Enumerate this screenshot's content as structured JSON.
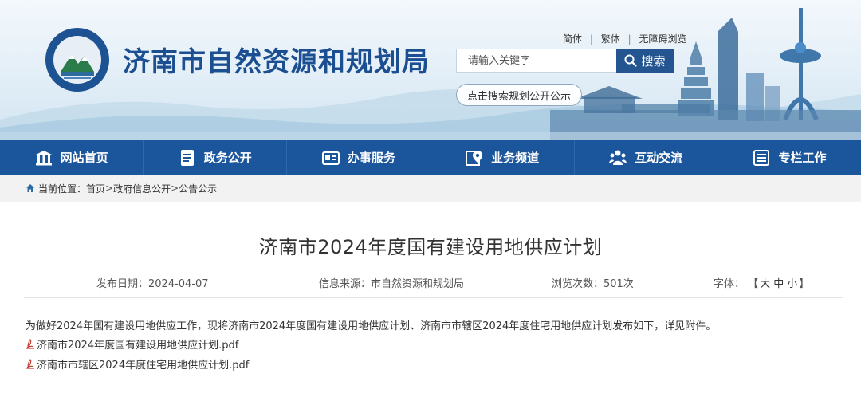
{
  "header": {
    "site_title": "济南市自然资源和规划局",
    "logo_text": "济南市自然资源和规划局",
    "lang_links": [
      "简体",
      "繁体",
      "无障碍浏览"
    ],
    "search_placeholder": "请输入关键字",
    "search_button": "搜索",
    "search_plan_link": "点击搜索规划公开公示"
  },
  "nav": {
    "items": [
      {
        "label": "网站首页",
        "icon": "building-icon"
      },
      {
        "label": "政务公开",
        "icon": "document-icon"
      },
      {
        "label": "办事服务",
        "icon": "id-card-icon"
      },
      {
        "label": "业务频道",
        "icon": "map-pin-icon"
      },
      {
        "label": "互动交流",
        "icon": "people-icon"
      },
      {
        "label": "专栏工作",
        "icon": "panel-icon"
      }
    ]
  },
  "breadcrumb": {
    "prefix": "当前位置：",
    "items": [
      "首页",
      "政府信息公开",
      "公告公示"
    ],
    "separator": ">"
  },
  "article": {
    "title": "济南市2024年度国有建设用地供应计划",
    "meta": {
      "date_label": "发布日期：",
      "date": "2024-04-07",
      "source_label": "信息来源：",
      "source": "市自然资源和规划局",
      "views_label": "浏览次数：",
      "views": "501次",
      "font_label": "字体：",
      "font_open": "【",
      "font_options": [
        "大",
        "中",
        "小"
      ],
      "font_close": "】"
    },
    "body": "为做好2024年国有建设用地供应工作，现将济南市2024年度国有建设用地供应计划、济南市市辖区2024年度住宅用地供应计划发布如下，详见附件。",
    "attachments": [
      {
        "name": "济南市2024年度国有建设用地供应计划.pdf",
        "icon": "pdf-icon"
      },
      {
        "name": "济南市市辖区2024年度住宅用地供应计划.pdf",
        "icon": "pdf-icon"
      }
    ]
  },
  "colors": {
    "nav_bg": "#1b559b",
    "title_blue": "#1b4f91",
    "search_button_bg": "#245590",
    "breadcrumb_bg": "#f2f2f2"
  }
}
